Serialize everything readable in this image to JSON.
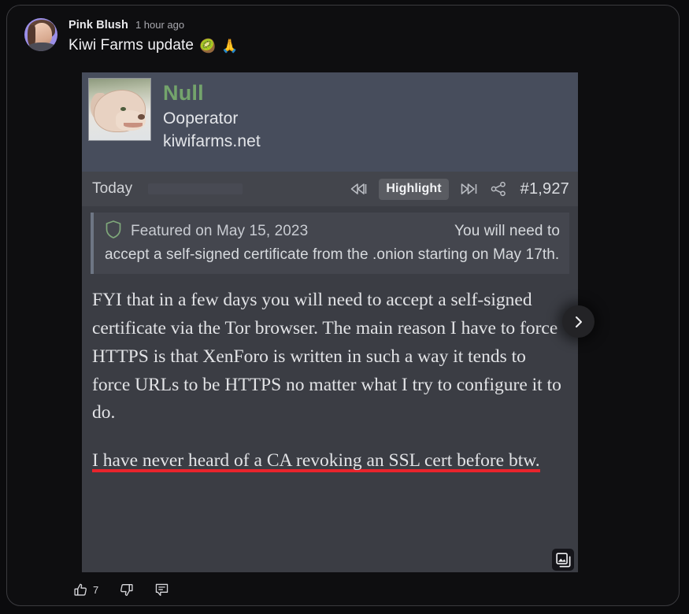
{
  "post": {
    "author": "Pink Blush",
    "timestamp": "1 hour ago",
    "title": "Kiwi Farms update",
    "emoji_kiwi": "🥝",
    "emoji_pray": "🙏",
    "avatar_icon": "user-avatar"
  },
  "card": {
    "profile": {
      "avatar_icon": "dog-avatar",
      "name": "Null",
      "role": "Ooperator",
      "site": "kiwifarms.net",
      "name_color": "#74a46c"
    },
    "toolbar": {
      "date_label": "Today",
      "redacted_label": "",
      "rewind_icon": "rewind-icon",
      "highlight_label": "Highlight",
      "fastforward_icon": "fast-forward-icon",
      "share_icon": "share-icon",
      "post_number": "#1,927"
    },
    "quote": {
      "shield_icon": "shield-icon",
      "featured_label": "Featured on May 15, 2023",
      "tail_line": "You will need to",
      "rest": "accept a self-signed certificate from the .onion starting on May 17th."
    },
    "body": {
      "paragraph_1": "FYI that in a few days you will need to accept a self-signed certificate via the Tor browser. The main reason I have to force HTTPS is that XenForo is written in such a way it tends to force URLs to be HTTPS no matter what I try to configure it to do.",
      "paragraph_2": "I have never heard of a CA revoking an SSL cert before btw.",
      "highlight_color": "#e8242c"
    },
    "next_button_icon": "chevron-right-icon",
    "gallery_badge_icon": "gallery-images-icon"
  },
  "actions": {
    "like_icon": "thumbs-up-icon",
    "like_count": "7",
    "dislike_icon": "thumbs-down-icon",
    "comment_icon": "comment-icon"
  }
}
